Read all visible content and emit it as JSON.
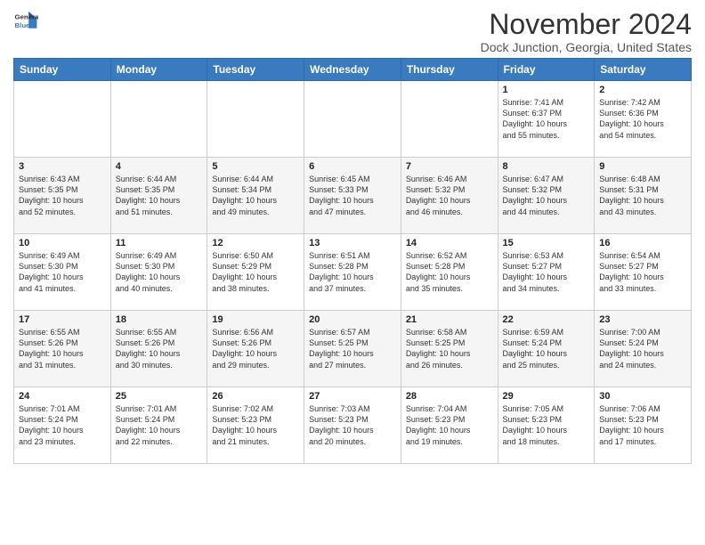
{
  "header": {
    "logo_line1": "General",
    "logo_line2": "Blue",
    "month_year": "November 2024",
    "location": "Dock Junction, Georgia, United States"
  },
  "weekdays": [
    "Sunday",
    "Monday",
    "Tuesday",
    "Wednesday",
    "Thursday",
    "Friday",
    "Saturday"
  ],
  "weeks": [
    [
      {
        "day": "",
        "info": ""
      },
      {
        "day": "",
        "info": ""
      },
      {
        "day": "",
        "info": ""
      },
      {
        "day": "",
        "info": ""
      },
      {
        "day": "",
        "info": ""
      },
      {
        "day": "1",
        "info": "Sunrise: 7:41 AM\nSunset: 6:37 PM\nDaylight: 10 hours\nand 55 minutes."
      },
      {
        "day": "2",
        "info": "Sunrise: 7:42 AM\nSunset: 6:36 PM\nDaylight: 10 hours\nand 54 minutes."
      }
    ],
    [
      {
        "day": "3",
        "info": "Sunrise: 6:43 AM\nSunset: 5:35 PM\nDaylight: 10 hours\nand 52 minutes."
      },
      {
        "day": "4",
        "info": "Sunrise: 6:44 AM\nSunset: 5:35 PM\nDaylight: 10 hours\nand 51 minutes."
      },
      {
        "day": "5",
        "info": "Sunrise: 6:44 AM\nSunset: 5:34 PM\nDaylight: 10 hours\nand 49 minutes."
      },
      {
        "day": "6",
        "info": "Sunrise: 6:45 AM\nSunset: 5:33 PM\nDaylight: 10 hours\nand 47 minutes."
      },
      {
        "day": "7",
        "info": "Sunrise: 6:46 AM\nSunset: 5:32 PM\nDaylight: 10 hours\nand 46 minutes."
      },
      {
        "day": "8",
        "info": "Sunrise: 6:47 AM\nSunset: 5:32 PM\nDaylight: 10 hours\nand 44 minutes."
      },
      {
        "day": "9",
        "info": "Sunrise: 6:48 AM\nSunset: 5:31 PM\nDaylight: 10 hours\nand 43 minutes."
      }
    ],
    [
      {
        "day": "10",
        "info": "Sunrise: 6:49 AM\nSunset: 5:30 PM\nDaylight: 10 hours\nand 41 minutes."
      },
      {
        "day": "11",
        "info": "Sunrise: 6:49 AM\nSunset: 5:30 PM\nDaylight: 10 hours\nand 40 minutes."
      },
      {
        "day": "12",
        "info": "Sunrise: 6:50 AM\nSunset: 5:29 PM\nDaylight: 10 hours\nand 38 minutes."
      },
      {
        "day": "13",
        "info": "Sunrise: 6:51 AM\nSunset: 5:28 PM\nDaylight: 10 hours\nand 37 minutes."
      },
      {
        "day": "14",
        "info": "Sunrise: 6:52 AM\nSunset: 5:28 PM\nDaylight: 10 hours\nand 35 minutes."
      },
      {
        "day": "15",
        "info": "Sunrise: 6:53 AM\nSunset: 5:27 PM\nDaylight: 10 hours\nand 34 minutes."
      },
      {
        "day": "16",
        "info": "Sunrise: 6:54 AM\nSunset: 5:27 PM\nDaylight: 10 hours\nand 33 minutes."
      }
    ],
    [
      {
        "day": "17",
        "info": "Sunrise: 6:55 AM\nSunset: 5:26 PM\nDaylight: 10 hours\nand 31 minutes."
      },
      {
        "day": "18",
        "info": "Sunrise: 6:55 AM\nSunset: 5:26 PM\nDaylight: 10 hours\nand 30 minutes."
      },
      {
        "day": "19",
        "info": "Sunrise: 6:56 AM\nSunset: 5:26 PM\nDaylight: 10 hours\nand 29 minutes."
      },
      {
        "day": "20",
        "info": "Sunrise: 6:57 AM\nSunset: 5:25 PM\nDaylight: 10 hours\nand 27 minutes."
      },
      {
        "day": "21",
        "info": "Sunrise: 6:58 AM\nSunset: 5:25 PM\nDaylight: 10 hours\nand 26 minutes."
      },
      {
        "day": "22",
        "info": "Sunrise: 6:59 AM\nSunset: 5:24 PM\nDaylight: 10 hours\nand 25 minutes."
      },
      {
        "day": "23",
        "info": "Sunrise: 7:00 AM\nSunset: 5:24 PM\nDaylight: 10 hours\nand 24 minutes."
      }
    ],
    [
      {
        "day": "24",
        "info": "Sunrise: 7:01 AM\nSunset: 5:24 PM\nDaylight: 10 hours\nand 23 minutes."
      },
      {
        "day": "25",
        "info": "Sunrise: 7:01 AM\nSunset: 5:24 PM\nDaylight: 10 hours\nand 22 minutes."
      },
      {
        "day": "26",
        "info": "Sunrise: 7:02 AM\nSunset: 5:23 PM\nDaylight: 10 hours\nand 21 minutes."
      },
      {
        "day": "27",
        "info": "Sunrise: 7:03 AM\nSunset: 5:23 PM\nDaylight: 10 hours\nand 20 minutes."
      },
      {
        "day": "28",
        "info": "Sunrise: 7:04 AM\nSunset: 5:23 PM\nDaylight: 10 hours\nand 19 minutes."
      },
      {
        "day": "29",
        "info": "Sunrise: 7:05 AM\nSunset: 5:23 PM\nDaylight: 10 hours\nand 18 minutes."
      },
      {
        "day": "30",
        "info": "Sunrise: 7:06 AM\nSunset: 5:23 PM\nDaylight: 10 hours\nand 17 minutes."
      }
    ]
  ]
}
